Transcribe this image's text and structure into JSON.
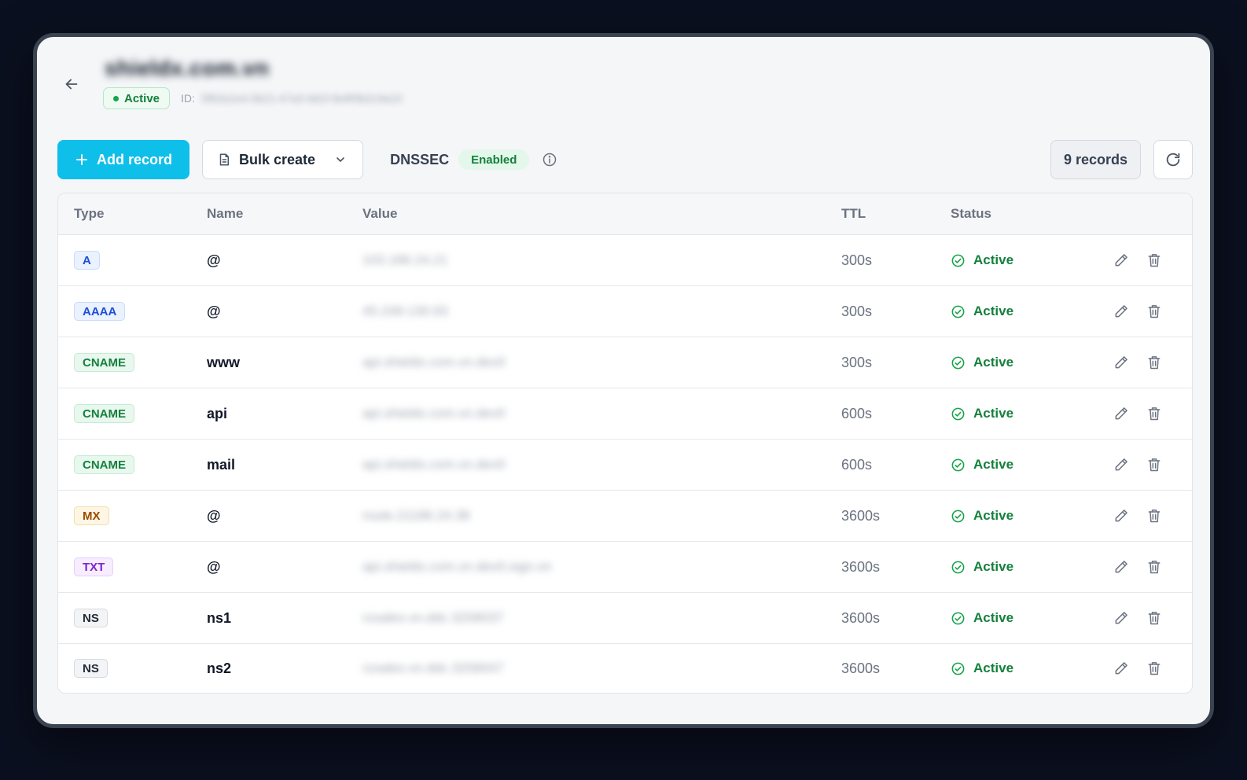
{
  "header": {
    "title": "shieldx.com.vn",
    "status": "Active",
    "id_label": "ID:",
    "id_value": "5f62a1e4-0b21-47a3-9d1f-6e8f3b2c9a10"
  },
  "toolbar": {
    "add_label": "Add record",
    "bulk_label": "Bulk create",
    "dnssec_label": "DNSSEC",
    "dnssec_status": "Enabled",
    "record_count": "9 records"
  },
  "table": {
    "columns": {
      "type": "Type",
      "name": "Name",
      "value": "Value",
      "ttl": "TTL",
      "status": "Status"
    },
    "rows": [
      {
        "type": "A",
        "name": "@",
        "value": "103.186.24.21",
        "ttl": "300s",
        "status": "Active"
      },
      {
        "type": "AAAA",
        "name": "@",
        "value": "45.249.130.93",
        "ttl": "300s",
        "status": "Active"
      },
      {
        "type": "CNAME",
        "name": "www",
        "value": "api.shieldx.com.vn.dev0",
        "ttl": "300s",
        "status": "Active"
      },
      {
        "type": "CNAME",
        "name": "api",
        "value": "api.shieldx.com.vn.dev0",
        "ttl": "600s",
        "status": "Active"
      },
      {
        "type": "CNAME",
        "name": "mail",
        "value": "api.shieldx.com.vn.dev0",
        "ttl": "600s",
        "status": "Active"
      },
      {
        "type": "MX",
        "name": "@",
        "value": "route.21186.24.38",
        "ttl": "3600s",
        "status": "Active"
      },
      {
        "type": "TXT",
        "name": "@",
        "value": "api.shieldx.com.vn.dev0.sign.vn",
        "ttl": "3600s",
        "status": "Active"
      },
      {
        "type": "NS",
        "name": "ns1",
        "value": "rzsales.vn.ddc.3258037",
        "ttl": "3600s",
        "status": "Active"
      },
      {
        "type": "NS",
        "name": "ns2",
        "value": "rzsales.vn.ddc.3258047",
        "ttl": "3600s",
        "status": "Active"
      }
    ]
  },
  "colors": {
    "accent": "#0ebfea",
    "success": "#15803d",
    "background": "#0b1020"
  }
}
